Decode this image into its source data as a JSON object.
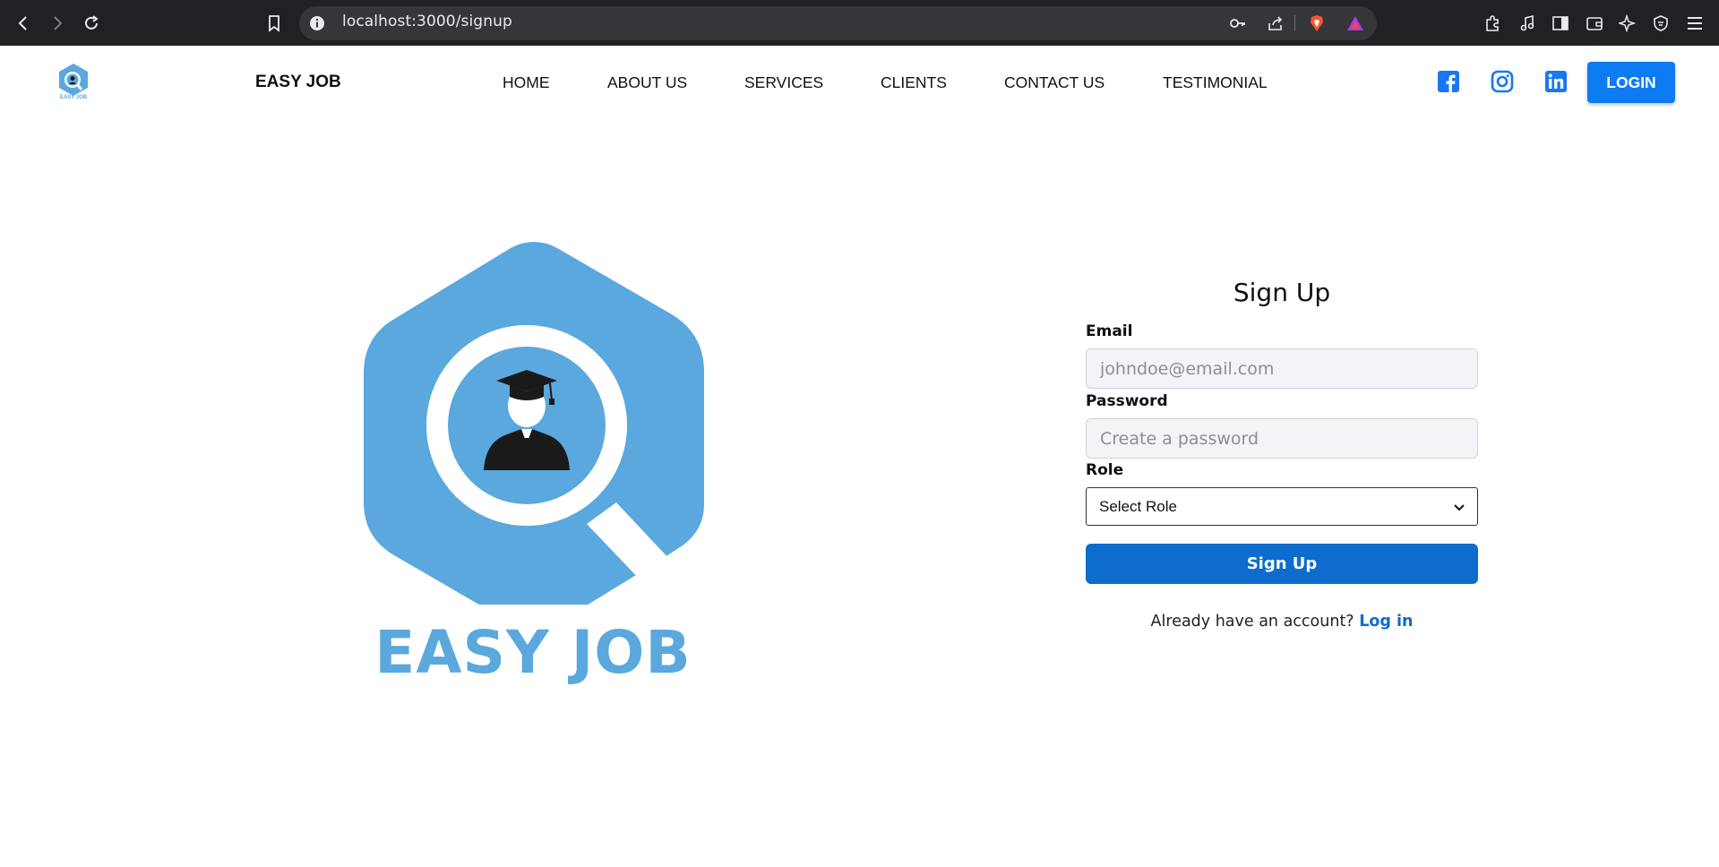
{
  "browser": {
    "url": "localhost:3000/signup",
    "icons": [
      "back-icon",
      "forward-icon",
      "reload-icon",
      "bookmark-icon",
      "site-info-icon",
      "key-icon",
      "share-icon",
      "brave-shields-icon",
      "brave-rewards-icon",
      "extensions-icon",
      "media-icon",
      "sidebar-icon",
      "wallet-icon",
      "leo-ai-icon",
      "vpn-icon",
      "menu-icon"
    ]
  },
  "nav": {
    "brand": "EASY JOB",
    "links": [
      "HOME",
      "ABOUT US",
      "SERVICES",
      "CLIENTS",
      "CONTACT US",
      "TESTIMONIAL"
    ],
    "social": [
      "facebook-icon",
      "instagram-icon",
      "linkedin-icon"
    ],
    "login": "LOGIN",
    "logo_caption": "EASY JOB"
  },
  "hero": {
    "logo_text": "EASY JOB"
  },
  "form": {
    "title": "Sign Up",
    "email_label": "Email",
    "email_placeholder": "johndoe@email.com",
    "password_label": "Password",
    "password_placeholder": "Create a password",
    "role_label": "Role",
    "role_selected": "Select Role",
    "submit": "Sign Up",
    "have_account": "Already have an account?",
    "login_link": "Log in"
  },
  "colors": {
    "brand_blue": "#5aa8dd",
    "button_blue": "#0d6ccc",
    "login_blue": "#0d7bf2",
    "chrome_dark": "#202124"
  }
}
